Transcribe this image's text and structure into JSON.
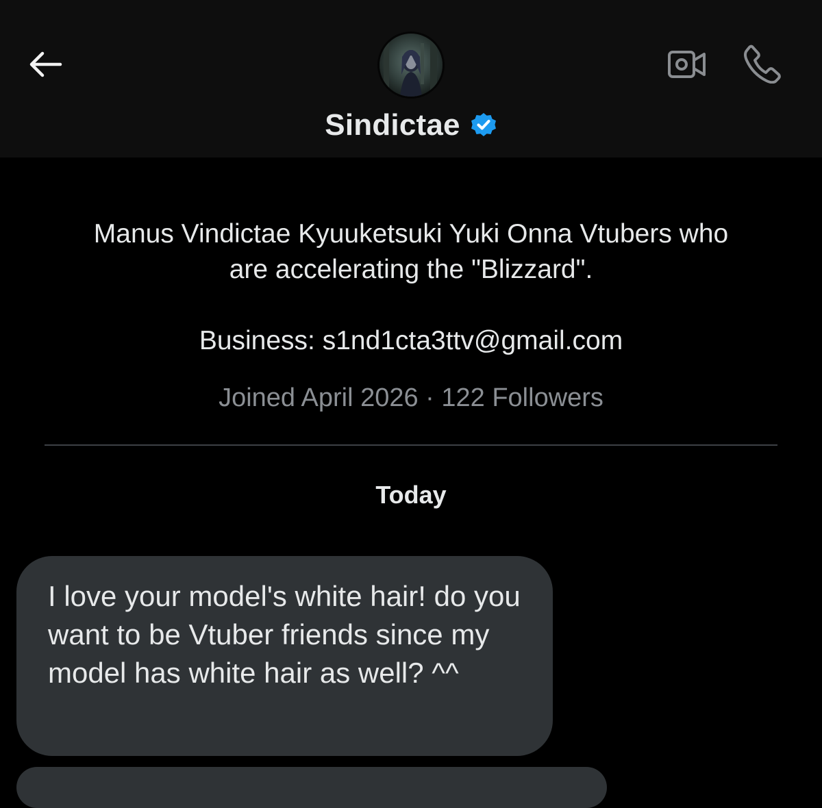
{
  "header": {
    "name": "Sindictae",
    "verified": true,
    "accent_color": "#1d9bf0",
    "icons": {
      "back": "arrow-left-icon",
      "video": "video-camera-icon",
      "call": "phone-icon",
      "badge": "verified-badge-icon"
    }
  },
  "profile": {
    "bio": "Manus Vindictae Kyuuketsuki Yuki Onna Vtubers who\nare accelerating the \"Blizzard\".\n\nBusiness: s1nd1cta3ttv@gmail.com",
    "meta": "Joined April 2026 · 122 Followers"
  },
  "conversation": {
    "date_separator": "Today",
    "messages": [
      {
        "text": "I love your model's white hair! do you want to be Vtuber friends since my model has white hair as well? ^^"
      }
    ]
  }
}
